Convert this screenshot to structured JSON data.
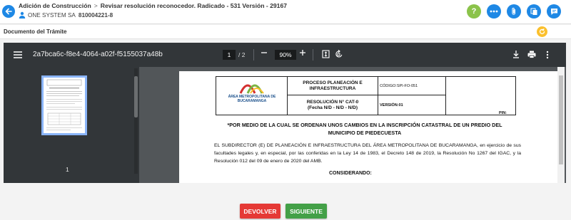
{
  "header": {
    "breadcrumb": [
      "Adición de Construcción",
      "Revisar resolución reconocedor. Radicado - 531 Versión - 29167"
    ],
    "breadcrumb_separator": ">",
    "company_name": "ONE SYSTEM SA",
    "company_nit": "810004221-8",
    "help_label": "?"
  },
  "section": {
    "title": "Documento del Trámite"
  },
  "viewer": {
    "file_name": "2a7bca6c-f8e4-4064-a02f-f5155037a48b",
    "current_page": "1",
    "total_pages": "/ 2",
    "zoom": "90%",
    "thumbnail_page_number": "1"
  },
  "document": {
    "process_title": "PROCESO PLANEACIÓN E INFRAESTRUCTURA",
    "codigo": "CÓDIGO:SPI-FO-051",
    "resolution_title": "RESOLUCIÓN N° CAT-0",
    "resolution_date": "(Fecha N/D - N/D - N/D)",
    "version": "VERSIÓN:01",
    "pin_label": "PIN:",
    "logo_text": "ÁREA METROPOLITANA DE BUCARAMANGA",
    "heading": "*POR MEDIO DE LA CUAL SE ORDENAN UNOS CAMBIOS EN LA INSCRIPCIÓN CATASTRAL DE UN PREDIO DEL MUNICIPIO DE PIEDECUESTA",
    "body": "EL SUBDIRECTOR (E) DE PLANEACIÓN E INFRAESTRUCTURA DEL ÁREA METROPOLITANA DE BUCARAMANGA, en ejercicio de sus facultades legales y, en especial, por las conferidas en la Ley 14 de 1983, el Decreto 148 de 2019, la Resolución No 1267 del IGAC, y la Resolución 012 del 09 de enero de 2020 del AMB.",
    "considerando": "CONSIDERANDO:"
  },
  "buttons": {
    "devolver": "DEVOLVER",
    "siguiente": "SIGUIENTE"
  },
  "colors": {
    "primary": "#1e88e5",
    "help": "#8bc34a",
    "refresh": "#fbc02d",
    "danger": "#e53935",
    "success": "#43a047",
    "logo_red": "#d32f2f",
    "logo_green": "#7cb342"
  }
}
